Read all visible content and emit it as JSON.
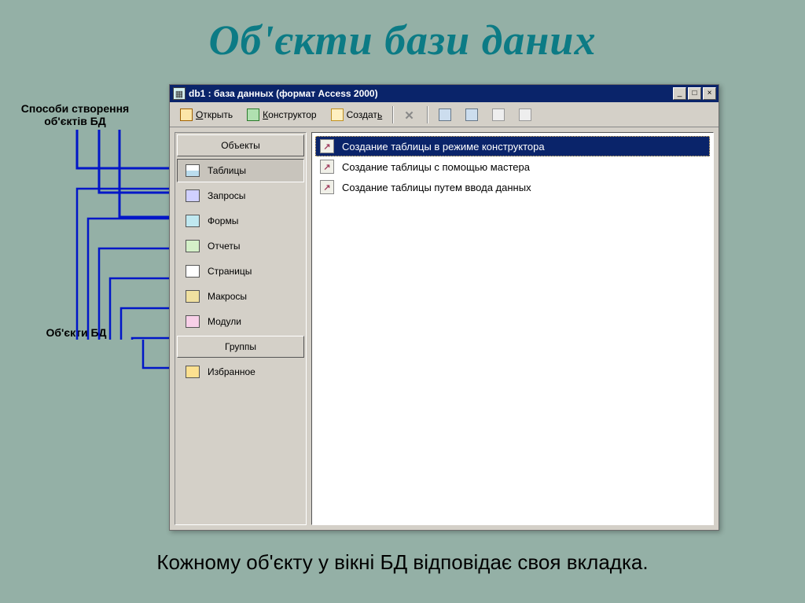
{
  "slide": {
    "title": "Об'єкти бази даних",
    "callout_top": "Способи створення об'єктів БД",
    "callout_mid": "Об'єкти БД",
    "footer": "Кожному об'єкту у вікні БД відповідає своя вкладка."
  },
  "window": {
    "title": "db1 : база данных (формат Access 2000)"
  },
  "toolbar": {
    "open": "Открыть",
    "design": "Конструктор",
    "new": "Создать"
  },
  "objects_header": "Объекты",
  "groups_header": "Группы",
  "objects": [
    {
      "label": "Таблицы",
      "icon": "tables"
    },
    {
      "label": "Запросы",
      "icon": "queries"
    },
    {
      "label": "Формы",
      "icon": "forms"
    },
    {
      "label": "Отчеты",
      "icon": "reports"
    },
    {
      "label": "Страницы",
      "icon": "pages"
    },
    {
      "label": "Макросы",
      "icon": "macros"
    },
    {
      "label": "Модули",
      "icon": "modules"
    }
  ],
  "favorites": "Избранное",
  "list": [
    {
      "label": "Создание таблицы в режиме конструктора"
    },
    {
      "label": "Создание таблицы с помощью мастера"
    },
    {
      "label": "Создание таблицы путем ввода данных"
    }
  ]
}
